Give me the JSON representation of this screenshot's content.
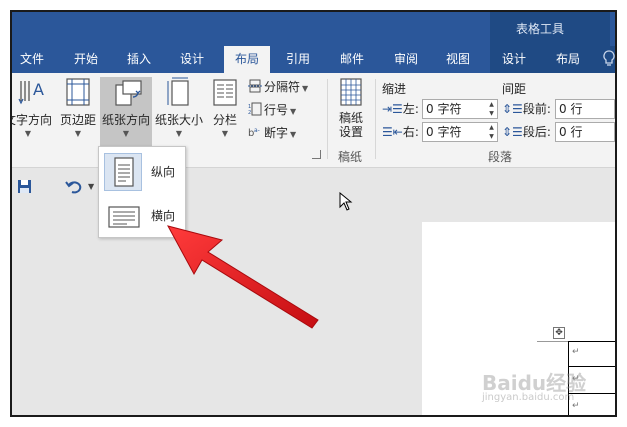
{
  "context_tab_group": "表格工具",
  "tabs": [
    {
      "label": "文件",
      "active": false
    },
    {
      "label": "开始",
      "active": false
    },
    {
      "label": "插入",
      "active": false
    },
    {
      "label": "设计",
      "active": false
    },
    {
      "label": "布局",
      "active": true
    },
    {
      "label": "引用",
      "active": false
    },
    {
      "label": "邮件",
      "active": false
    },
    {
      "label": "审阅",
      "active": false
    },
    {
      "label": "视图",
      "active": false
    },
    {
      "label": "设计",
      "active": false
    },
    {
      "label": "布局",
      "active": false
    }
  ],
  "ribbon": {
    "text_direction": "文字方向",
    "margins": "页边距",
    "orientation": "纸张方向",
    "size": "纸张大小",
    "columns": "分栏",
    "breaks": "分隔符",
    "line_numbers": "行号",
    "hyphenation": "断字",
    "manuscript_line1": "稿纸",
    "manuscript_line2": "设置",
    "manuscript_group": "稿纸",
    "indent_header": "缩进",
    "spacing_header": "间距",
    "indent_left_label": "左:",
    "indent_left_value": "0 字符",
    "indent_right_label": "右:",
    "indent_right_value": "0 字符",
    "spacing_before_label": "段前:",
    "spacing_before_value": "0 行",
    "spacing_after_label": "段后:",
    "spacing_after_value": "0 行",
    "paragraph_group": "段落"
  },
  "orientation_menu": {
    "portrait": "纵向",
    "landscape": "横向"
  },
  "watermark": {
    "brand": "Baidu经验",
    "url": "jingyan.baidu.com"
  },
  "colors": {
    "tab_bar": "#2b579a",
    "context_tab": "#1f4a84",
    "ribbon": "#f3f3f3",
    "annotation_arrow": "#e8141b"
  }
}
